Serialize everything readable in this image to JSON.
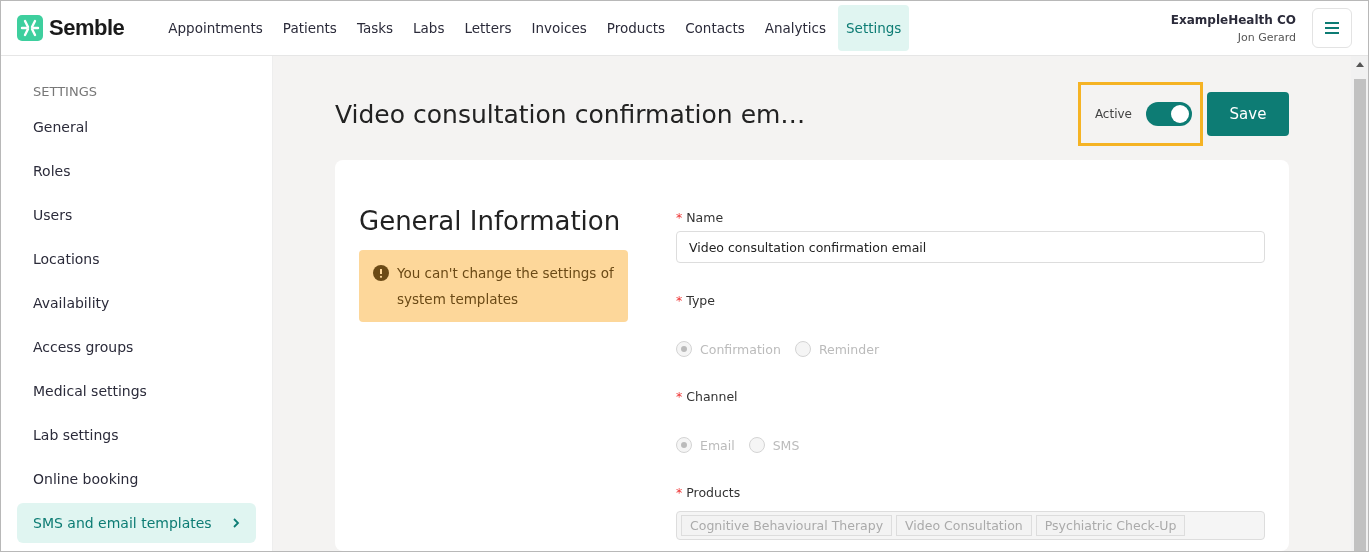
{
  "brand": {
    "name": "Semble"
  },
  "nav": [
    {
      "label": "Appointments",
      "selected": false
    },
    {
      "label": "Patients",
      "selected": false
    },
    {
      "label": "Tasks",
      "selected": false
    },
    {
      "label": "Labs",
      "selected": false
    },
    {
      "label": "Letters",
      "selected": false
    },
    {
      "label": "Invoices",
      "selected": false
    },
    {
      "label": "Products",
      "selected": false
    },
    {
      "label": "Contacts",
      "selected": false
    },
    {
      "label": "Analytics",
      "selected": false
    },
    {
      "label": "Settings",
      "selected": true
    }
  ],
  "account": {
    "organisation": "ExampleHealth CO",
    "user": "Jon Gerard"
  },
  "sidebar": {
    "heading": "SETTINGS",
    "items": [
      {
        "label": "General",
        "selected": false
      },
      {
        "label": "Roles",
        "selected": false
      },
      {
        "label": "Users",
        "selected": false
      },
      {
        "label": "Locations",
        "selected": false
      },
      {
        "label": "Availability",
        "selected": false
      },
      {
        "label": "Access groups",
        "selected": false
      },
      {
        "label": "Medical settings",
        "selected": false
      },
      {
        "label": "Lab settings",
        "selected": false
      },
      {
        "label": "Online booking",
        "selected": false
      },
      {
        "label": "SMS and email templates",
        "selected": true
      }
    ]
  },
  "page": {
    "title": "Video consultation confirmation em…",
    "active_label": "Active",
    "active": true,
    "save": "Save"
  },
  "section": {
    "title": "General Information",
    "notice": "You can't change the settings of system templates"
  },
  "form": {
    "required_mark": "*",
    "name": {
      "label": "Name",
      "value": "Video consultation confirmation email"
    },
    "type": {
      "label": "Type",
      "options": [
        {
          "label": "Confirmation",
          "selected": true
        },
        {
          "label": "Reminder",
          "selected": false
        }
      ]
    },
    "channel": {
      "label": "Channel",
      "options": [
        {
          "label": "Email",
          "selected": true
        },
        {
          "label": "SMS",
          "selected": false
        }
      ]
    },
    "products": {
      "label": "Products",
      "tags": [
        "Cognitive Behavioural Therapy",
        "Video Consultation",
        "Psychiatric Check-Up"
      ]
    }
  }
}
